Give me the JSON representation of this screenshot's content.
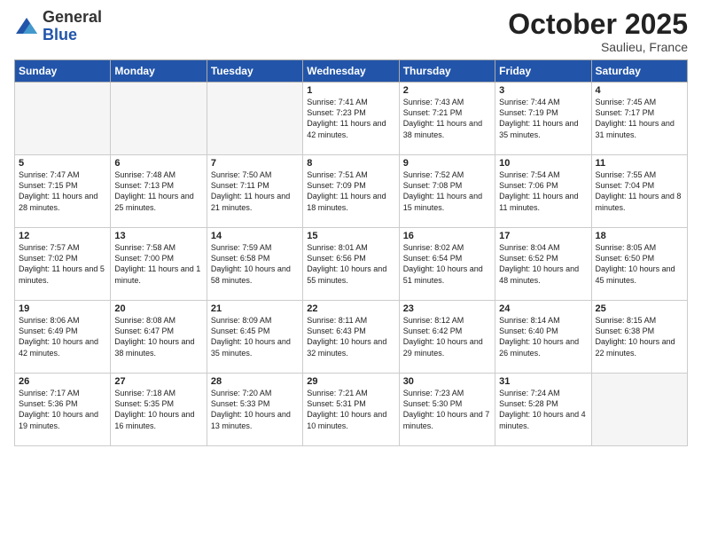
{
  "logo": {
    "general": "General",
    "blue": "Blue"
  },
  "header": {
    "month": "October 2025",
    "location": "Saulieu, France"
  },
  "days_of_week": [
    "Sunday",
    "Monday",
    "Tuesday",
    "Wednesday",
    "Thursday",
    "Friday",
    "Saturday"
  ],
  "weeks": [
    [
      {
        "day": "",
        "info": ""
      },
      {
        "day": "",
        "info": ""
      },
      {
        "day": "",
        "info": ""
      },
      {
        "day": "1",
        "info": "Sunrise: 7:41 AM\nSunset: 7:23 PM\nDaylight: 11 hours\nand 42 minutes."
      },
      {
        "day": "2",
        "info": "Sunrise: 7:43 AM\nSunset: 7:21 PM\nDaylight: 11 hours\nand 38 minutes."
      },
      {
        "day": "3",
        "info": "Sunrise: 7:44 AM\nSunset: 7:19 PM\nDaylight: 11 hours\nand 35 minutes."
      },
      {
        "day": "4",
        "info": "Sunrise: 7:45 AM\nSunset: 7:17 PM\nDaylight: 11 hours\nand 31 minutes."
      }
    ],
    [
      {
        "day": "5",
        "info": "Sunrise: 7:47 AM\nSunset: 7:15 PM\nDaylight: 11 hours\nand 28 minutes."
      },
      {
        "day": "6",
        "info": "Sunrise: 7:48 AM\nSunset: 7:13 PM\nDaylight: 11 hours\nand 25 minutes."
      },
      {
        "day": "7",
        "info": "Sunrise: 7:50 AM\nSunset: 7:11 PM\nDaylight: 11 hours\nand 21 minutes."
      },
      {
        "day": "8",
        "info": "Sunrise: 7:51 AM\nSunset: 7:09 PM\nDaylight: 11 hours\nand 18 minutes."
      },
      {
        "day": "9",
        "info": "Sunrise: 7:52 AM\nSunset: 7:08 PM\nDaylight: 11 hours\nand 15 minutes."
      },
      {
        "day": "10",
        "info": "Sunrise: 7:54 AM\nSunset: 7:06 PM\nDaylight: 11 hours\nand 11 minutes."
      },
      {
        "day": "11",
        "info": "Sunrise: 7:55 AM\nSunset: 7:04 PM\nDaylight: 11 hours\nand 8 minutes."
      }
    ],
    [
      {
        "day": "12",
        "info": "Sunrise: 7:57 AM\nSunset: 7:02 PM\nDaylight: 11 hours\nand 5 minutes."
      },
      {
        "day": "13",
        "info": "Sunrise: 7:58 AM\nSunset: 7:00 PM\nDaylight: 11 hours\nand 1 minute."
      },
      {
        "day": "14",
        "info": "Sunrise: 7:59 AM\nSunset: 6:58 PM\nDaylight: 10 hours\nand 58 minutes."
      },
      {
        "day": "15",
        "info": "Sunrise: 8:01 AM\nSunset: 6:56 PM\nDaylight: 10 hours\nand 55 minutes."
      },
      {
        "day": "16",
        "info": "Sunrise: 8:02 AM\nSunset: 6:54 PM\nDaylight: 10 hours\nand 51 minutes."
      },
      {
        "day": "17",
        "info": "Sunrise: 8:04 AM\nSunset: 6:52 PM\nDaylight: 10 hours\nand 48 minutes."
      },
      {
        "day": "18",
        "info": "Sunrise: 8:05 AM\nSunset: 6:50 PM\nDaylight: 10 hours\nand 45 minutes."
      }
    ],
    [
      {
        "day": "19",
        "info": "Sunrise: 8:06 AM\nSunset: 6:49 PM\nDaylight: 10 hours\nand 42 minutes."
      },
      {
        "day": "20",
        "info": "Sunrise: 8:08 AM\nSunset: 6:47 PM\nDaylight: 10 hours\nand 38 minutes."
      },
      {
        "day": "21",
        "info": "Sunrise: 8:09 AM\nSunset: 6:45 PM\nDaylight: 10 hours\nand 35 minutes."
      },
      {
        "day": "22",
        "info": "Sunrise: 8:11 AM\nSunset: 6:43 PM\nDaylight: 10 hours\nand 32 minutes."
      },
      {
        "day": "23",
        "info": "Sunrise: 8:12 AM\nSunset: 6:42 PM\nDaylight: 10 hours\nand 29 minutes."
      },
      {
        "day": "24",
        "info": "Sunrise: 8:14 AM\nSunset: 6:40 PM\nDaylight: 10 hours\nand 26 minutes."
      },
      {
        "day": "25",
        "info": "Sunrise: 8:15 AM\nSunset: 6:38 PM\nDaylight: 10 hours\nand 22 minutes."
      }
    ],
    [
      {
        "day": "26",
        "info": "Sunrise: 7:17 AM\nSunset: 5:36 PM\nDaylight: 10 hours\nand 19 minutes."
      },
      {
        "day": "27",
        "info": "Sunrise: 7:18 AM\nSunset: 5:35 PM\nDaylight: 10 hours\nand 16 minutes."
      },
      {
        "day": "28",
        "info": "Sunrise: 7:20 AM\nSunset: 5:33 PM\nDaylight: 10 hours\nand 13 minutes."
      },
      {
        "day": "29",
        "info": "Sunrise: 7:21 AM\nSunset: 5:31 PM\nDaylight: 10 hours\nand 10 minutes."
      },
      {
        "day": "30",
        "info": "Sunrise: 7:23 AM\nSunset: 5:30 PM\nDaylight: 10 hours\nand 7 minutes."
      },
      {
        "day": "31",
        "info": "Sunrise: 7:24 AM\nSunset: 5:28 PM\nDaylight: 10 hours\nand 4 minutes."
      },
      {
        "day": "",
        "info": ""
      }
    ]
  ]
}
